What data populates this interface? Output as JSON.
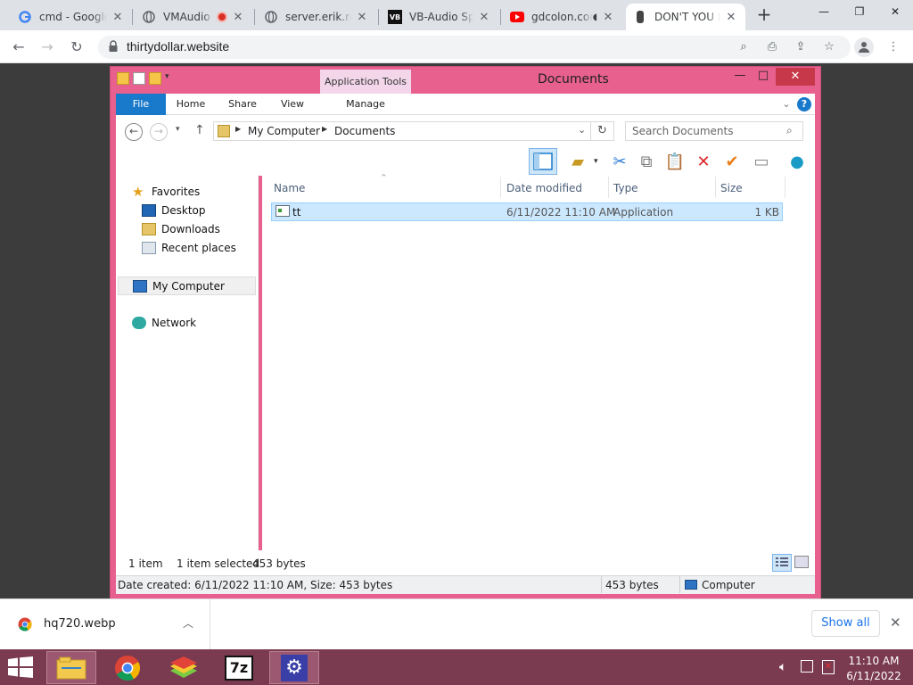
{
  "browser": {
    "tabs": [
      {
        "title": "cmd - Google",
        "icon": "google-icon"
      },
      {
        "title": "VMAudio",
        "icon": "globe-icon",
        "recording": true
      },
      {
        "title": "server.erik.red",
        "icon": "globe-icon"
      },
      {
        "title": "VB-Audio Spe",
        "icon": "vb-icon"
      },
      {
        "title": "gdcolon.com",
        "icon": "youtube-icon",
        "audio": true
      },
      {
        "title": "DON'T YOU L",
        "icon": "figure-icon",
        "active": true
      }
    ],
    "url": "thirtydollar.website"
  },
  "explorer": {
    "title": "Documents",
    "context_tab": "Application Tools",
    "ribbon_tabs": [
      "File",
      "Home",
      "Share",
      "View",
      "Manage"
    ],
    "breadcrumb": [
      "My Computer",
      "Documents"
    ],
    "search_placeholder": "Search Documents",
    "nav": {
      "favorites": "Favorites",
      "favorites_items": [
        "Desktop",
        "Downloads",
        "Recent places"
      ],
      "computer": "My Computer",
      "network": "Network"
    },
    "columns": [
      "Name",
      "Date modified",
      "Type",
      "Size"
    ],
    "files": [
      {
        "name": "tt",
        "date": "6/11/2022 11:10 AM",
        "type": "Application",
        "size": "1 KB"
      }
    ],
    "status": {
      "count": "1 item",
      "selected": "1 item selected",
      "bytes": "453 bytes"
    },
    "details": {
      "text": "Date created: 6/11/2022 11:10 AM, Size: 453 bytes",
      "size": "453 bytes",
      "location": "Computer"
    }
  },
  "downloads": {
    "file": "hq720.webp",
    "show_all": "Show all"
  },
  "taskbar": {
    "time": "11:10 AM",
    "date": "6/11/2022"
  },
  "colors": {
    "window_frame": "#e8608d",
    "file_tab": "#1979ca",
    "selection": "#cce8ff",
    "taskbar": "#7a3a50"
  }
}
